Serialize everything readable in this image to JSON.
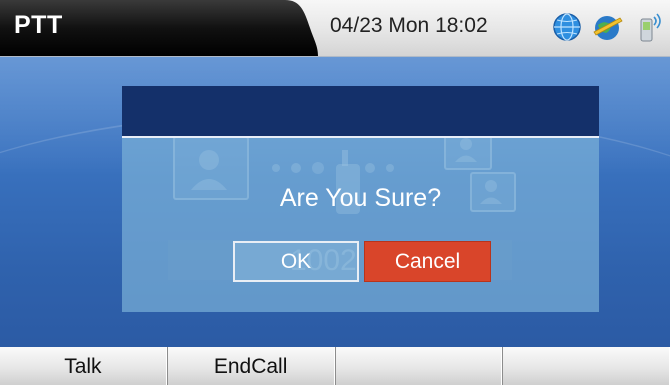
{
  "header": {
    "title": "PTT",
    "datetime": "04/23 Mon 18:02",
    "icons": [
      "globe-icon",
      "network-icon",
      "phone-signal-icon"
    ]
  },
  "dialog": {
    "message": "Are You Sure?",
    "ok_label": "OK",
    "cancel_label": "Cancel"
  },
  "background": {
    "number": "1002"
  },
  "softkeys": [
    {
      "label": "Talk"
    },
    {
      "label": "EndCall"
    },
    {
      "label": ""
    },
    {
      "label": ""
    }
  ],
  "colors": {
    "cancel": "#d9452a",
    "dialog_header": "#14306a",
    "screen": "#3a73c0"
  }
}
